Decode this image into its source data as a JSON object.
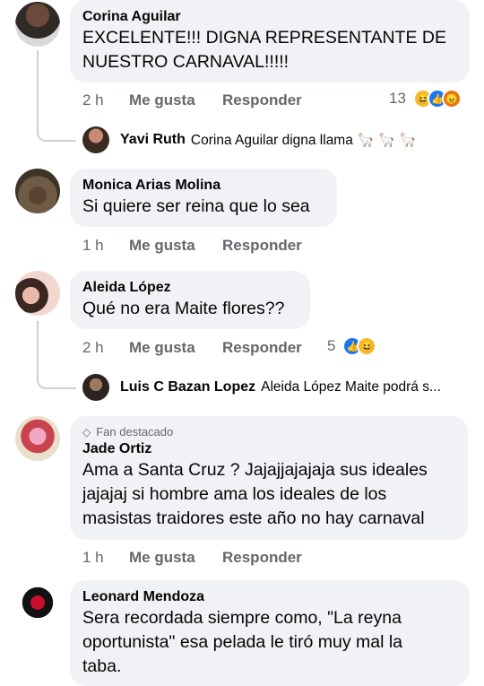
{
  "comments": [
    {
      "name": "Corina Aguilar",
      "lines": [
        "EXCELENTE!!! DIGNA REPRESENTANTE DE",
        "NUESTRO CARNAVAL!!!!!"
      ],
      "time": "2 h",
      "like_label": "Me gusta",
      "reply_label": "Responder",
      "reaction_count": "13",
      "reactions": [
        "haha",
        "like",
        "angry"
      ],
      "reply": {
        "name": "Yavi Ruth",
        "text": "Corina Aguilar digna llama 🦙 🦙 🦙"
      }
    },
    {
      "name": "Monica Arias Molina",
      "lines": [
        "Si quiere ser reina que lo sea"
      ],
      "time": "1 h",
      "like_label": "Me gusta",
      "reply_label": "Responder"
    },
    {
      "name": "Aleida López",
      "lines": [
        "Qué no era Maite flores??"
      ],
      "time": "2 h",
      "like_label": "Me gusta",
      "reply_label": "Responder",
      "reaction_count": "5",
      "reactions": [
        "like",
        "haha"
      ],
      "reply": {
        "name": "Luis C Bazan Lopez",
        "text": "Aleida López Maite podrá s..."
      }
    },
    {
      "badge": "Fan destacado",
      "name": "Jade Ortiz",
      "lines": [
        "Ama a Santa Cruz ? Jajajjajajaja sus ideales",
        "jajajaj si hombre ama los ideales de los",
        "masistas traidores este año no hay carnaval"
      ],
      "time": "1 h",
      "like_label": "Me gusta",
      "reply_label": "Responder"
    },
    {
      "name": "Leonard Mendoza",
      "lines": [
        "Sera recordada siempre como,  \"La reyna",
        "oportunista\" esa pelada le tiró muy mal la",
        "taba."
      ]
    }
  ],
  "colors": {
    "like": "#1877f2",
    "haha": "#f7b928",
    "angry": "#e9710f",
    "bubble": "#f0f2f5",
    "meta": "#65676b"
  }
}
